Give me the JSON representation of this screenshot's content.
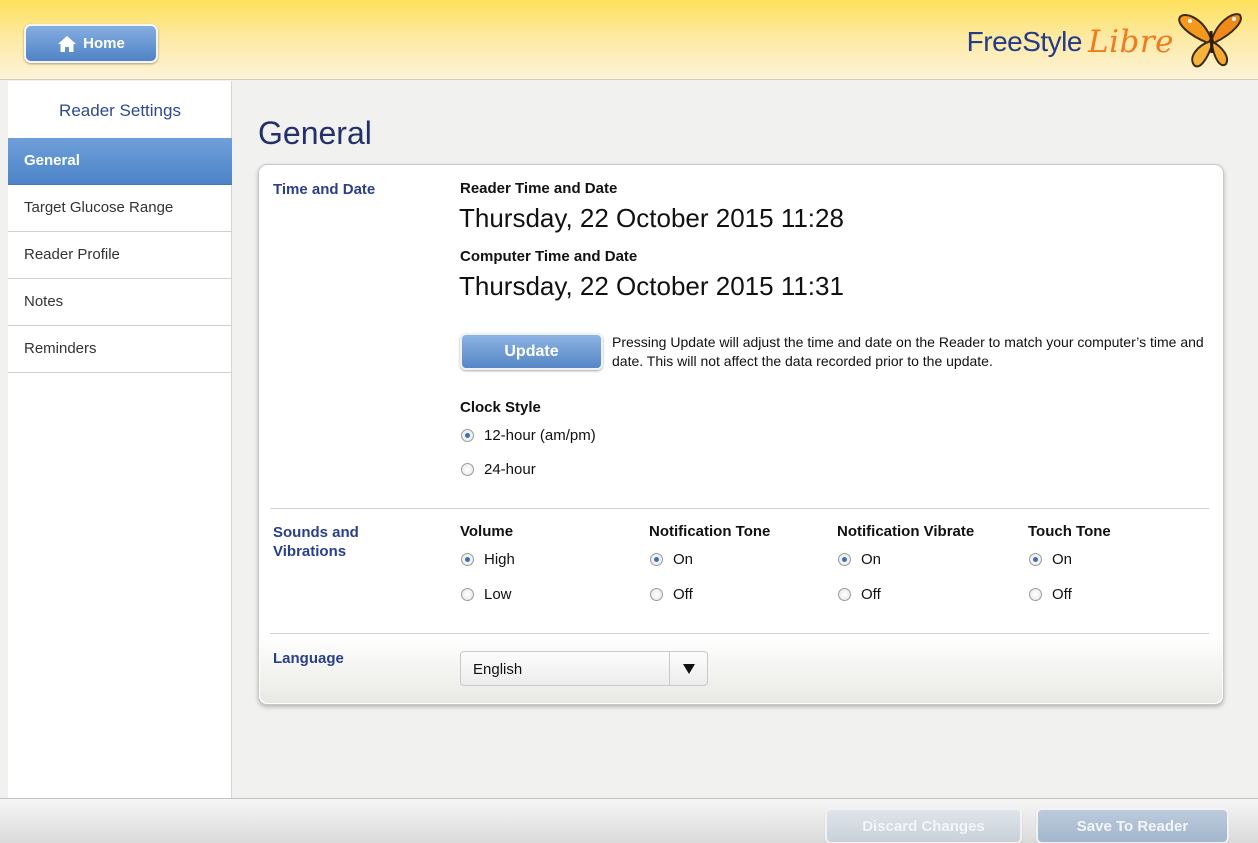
{
  "header": {
    "home_label": "Home",
    "logo_word1": "FreeStyle",
    "logo_word2": "Libre",
    "colors": {
      "brand_blue": "#233b88",
      "brand_orange": "#f07a1e",
      "header_yellow": "#fde15a"
    }
  },
  "sidebar": {
    "title": "Reader Settings",
    "items": [
      {
        "label": "General",
        "active": true
      },
      {
        "label": "Target Glucose Range",
        "active": false
      },
      {
        "label": "Reader Profile",
        "active": false
      },
      {
        "label": "Notes",
        "active": false
      },
      {
        "label": "Reminders",
        "active": false
      }
    ]
  },
  "main": {
    "title": "General",
    "time_date": {
      "section_label": "Time and Date",
      "reader_label": "Reader Time and Date",
      "reader_value": "Thursday, 22 October 2015 11:28",
      "computer_label": "Computer Time and Date",
      "computer_value": "Thursday, 22 October 2015 11:31",
      "update_label": "Update",
      "update_note": "Pressing Update will adjust the time and date on the Reader to match your computer’s time and date. This will not affect the data recorded prior to the update.",
      "clock_style_label": "Clock Style",
      "clock_options": [
        {
          "label": "12-hour (am/pm)",
          "checked": true
        },
        {
          "label": "24-hour",
          "checked": false
        }
      ]
    },
    "sounds": {
      "section_label_line1": "Sounds and",
      "section_label_line2": "Vibrations",
      "groups": [
        {
          "title": "Volume",
          "options": [
            {
              "label": "High",
              "checked": true
            },
            {
              "label": "Low",
              "checked": false
            }
          ]
        },
        {
          "title": "Notification Tone",
          "options": [
            {
              "label": "On",
              "checked": true
            },
            {
              "label": "Off",
              "checked": false
            }
          ]
        },
        {
          "title": "Notification Vibrate",
          "options": [
            {
              "label": "On",
              "checked": true
            },
            {
              "label": "Off",
              "checked": false
            }
          ]
        },
        {
          "title": "Touch Tone",
          "options": [
            {
              "label": "On",
              "checked": true
            },
            {
              "label": "Off",
              "checked": false
            }
          ]
        }
      ]
    },
    "language": {
      "section_label": "Language",
      "selected": "English"
    }
  },
  "footer": {
    "discard_label": "Discard Changes",
    "save_label": "Save To Reader"
  },
  "icons": {
    "home": "home-icon",
    "dropdown": "caret-down-icon",
    "logo": "butterfly-icon"
  }
}
